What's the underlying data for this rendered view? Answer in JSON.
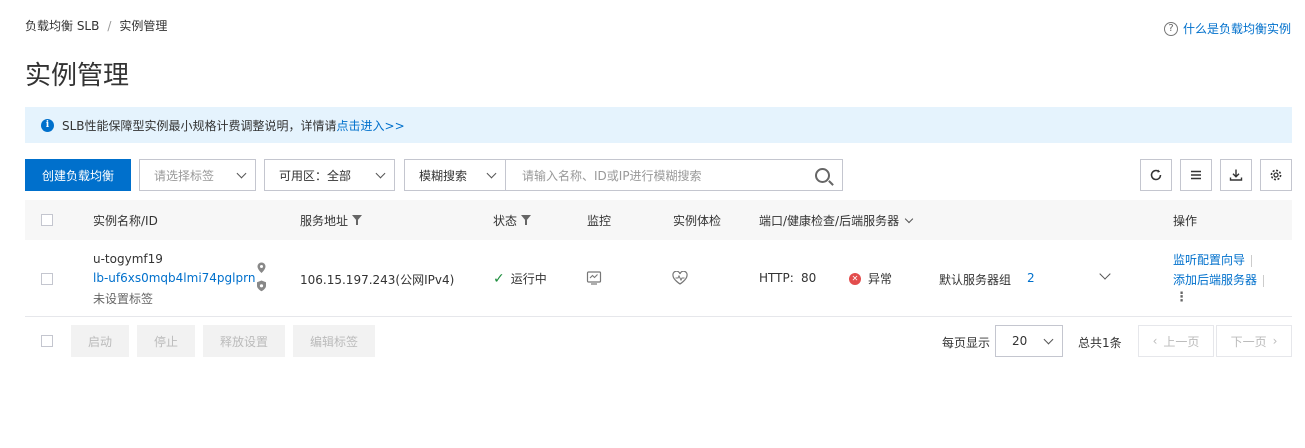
{
  "breadcrumb": {
    "parent": "负载均衡 SLB",
    "separator": "/",
    "current": "实例管理"
  },
  "help": {
    "label": "什么是负载均衡实例",
    "icon": "question-circle-icon"
  },
  "page": {
    "title": "实例管理"
  },
  "notice": {
    "text": "SLB性能保障型实例最小规格计费调整说明，详情请",
    "link": "点击进入>>",
    "icon": "info-icon"
  },
  "toolbar": {
    "create_label": "创建负载均衡",
    "tag_placeholder": "请选择标签",
    "zone_label": "可用区：全部",
    "search_mode": "模糊搜索",
    "search_placeholder": "请输入名称、ID或IP进行模糊搜索",
    "icons": [
      "refresh-icon",
      "list-icon",
      "download-icon",
      "settings-icon"
    ]
  },
  "table": {
    "headers": {
      "name": "实例名称/ID",
      "address": "服务地址",
      "status": "状态",
      "monitor": "监控",
      "check": "实例体检",
      "ports": "端口/健康检查/后端服务器",
      "actions": "操作"
    },
    "rows": [
      {
        "name": "u-togymf19",
        "id": "lb-uf6xs0mqb4lmi74pglprn",
        "tags": "未设置标签",
        "address": "106.15.197.243(公网IPv4)",
        "status": "运行中",
        "protocol": "HTTP:",
        "port": "80",
        "health": "异常",
        "server_group": "默认服务器组",
        "server_count": "2",
        "action1": "监听配置向导",
        "action2": "添加后端服务器",
        "more": "⋮"
      }
    ]
  },
  "footer": {
    "buttons": [
      "启动",
      "停止",
      "释放设置",
      "编辑标签"
    ],
    "page_size_label": "每页显示",
    "page_size": "20",
    "total": "总共1条",
    "prev": "上一页",
    "next": "下一页"
  },
  "colors": {
    "primary": "#0070cc",
    "notice_bg": "#e5f3fd",
    "ok": "#1e8e3e",
    "error": "#e34d4d"
  }
}
